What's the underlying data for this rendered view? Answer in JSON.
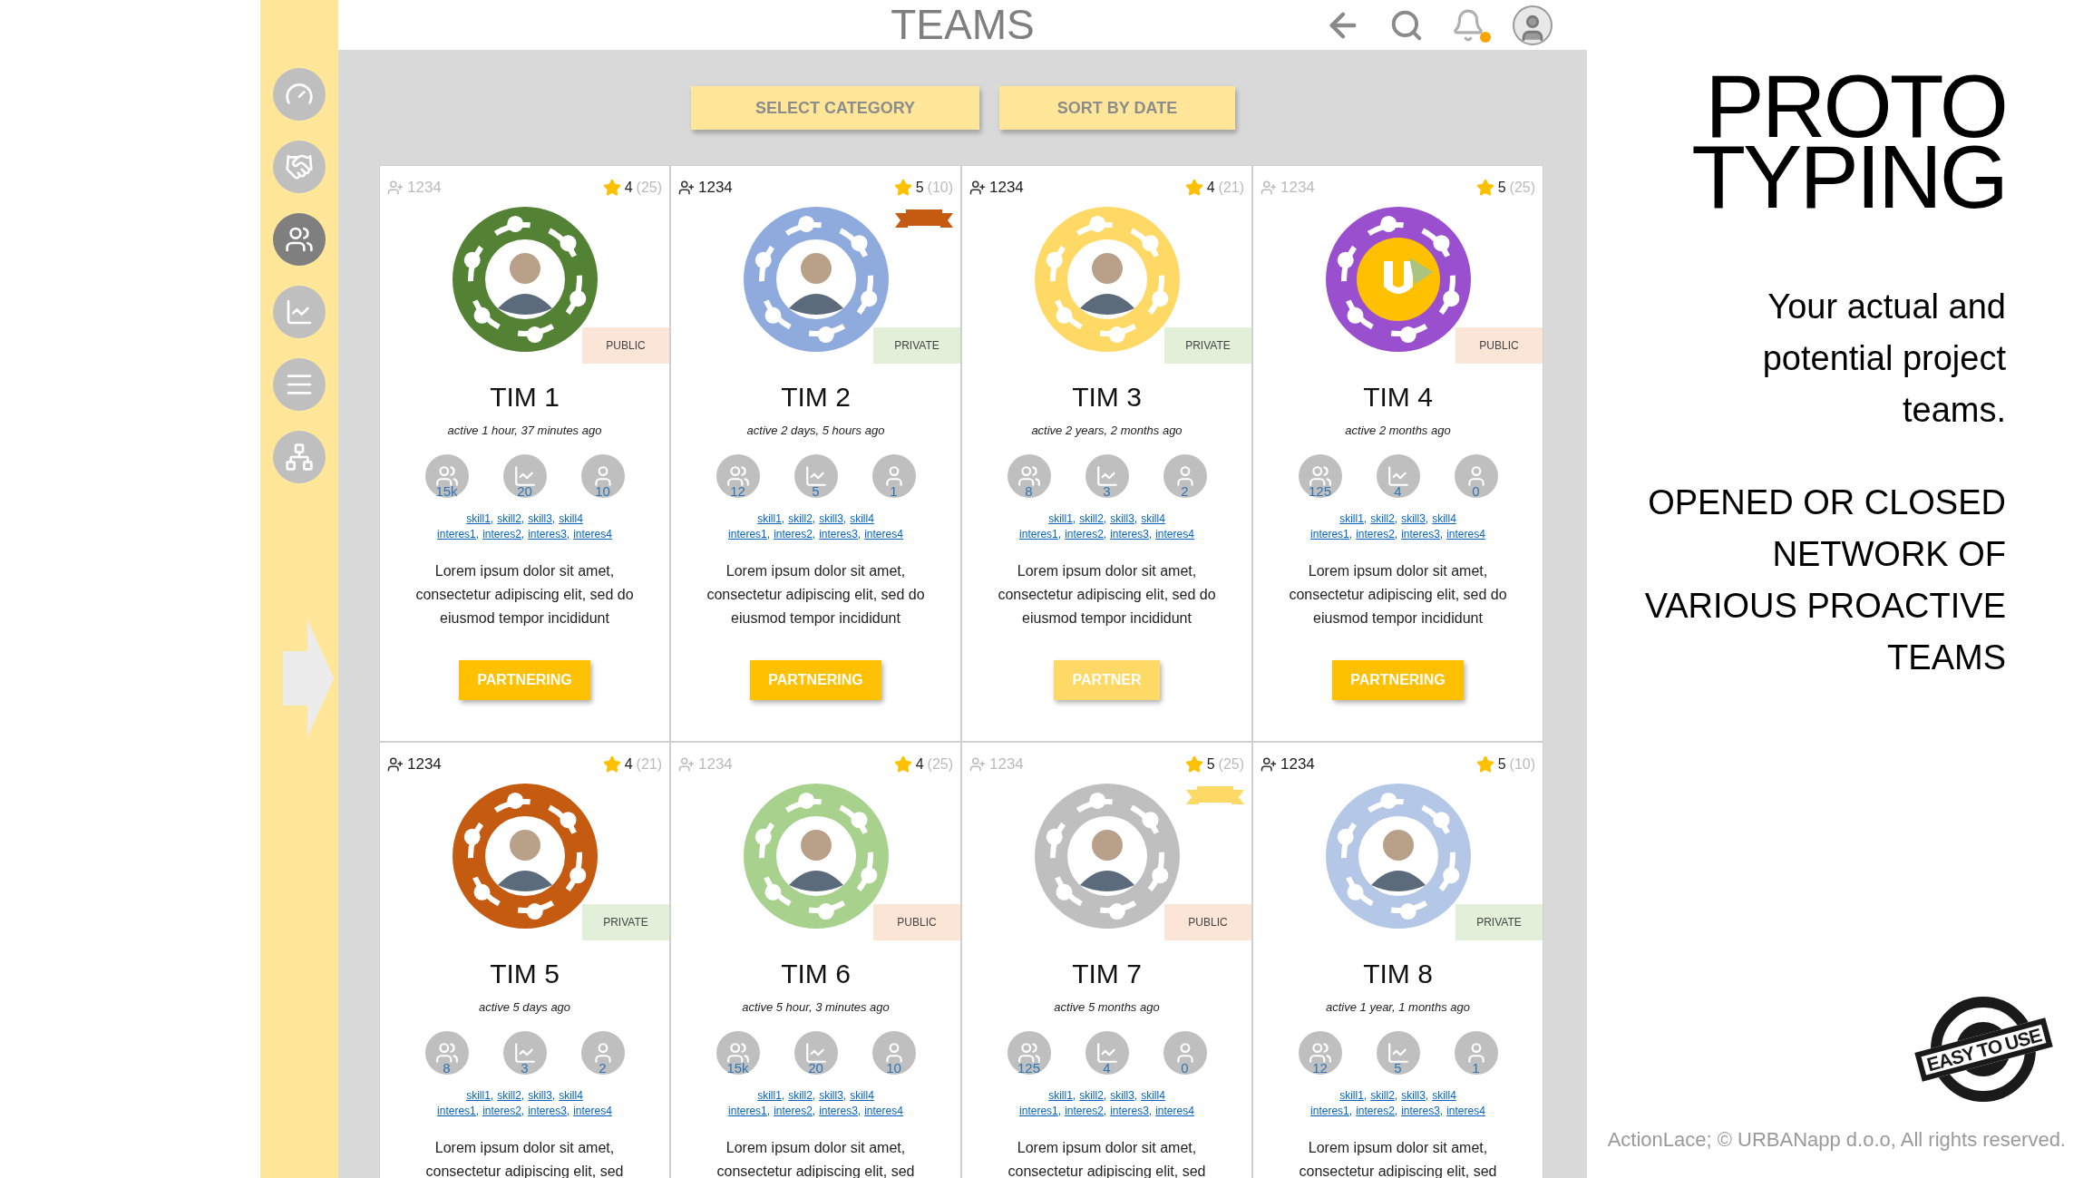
{
  "header": {
    "title": "TEAMS"
  },
  "sidebar": {
    "items": [
      {
        "kind": "gauge",
        "selected": false
      },
      {
        "kind": "handshake",
        "selected": false
      },
      {
        "kind": "teams",
        "selected": true
      },
      {
        "kind": "chart",
        "selected": false
      },
      {
        "kind": "list",
        "selected": false
      },
      {
        "kind": "network",
        "selected": false
      }
    ]
  },
  "filters": [
    "SELECT CATEGORY",
    "SORT BY DATE"
  ],
  "cards": [
    {
      "members": "1234",
      "members_highlighted": false,
      "rating": "4",
      "reviews": "(25)",
      "color": "#548235",
      "avatar": {
        "kind": "photo"
      },
      "visibility": {
        "label": "PUBLIC",
        "kind": "public"
      },
      "name": "TIM 1",
      "activity": "active 1 hour, 37 minutes ago",
      "stats": [
        "15k",
        "20",
        "10"
      ],
      "skills": [
        "skill1,",
        "skill2,",
        "skill3,",
        "skill4"
      ],
      "interests": [
        "interes1,",
        "interes2,",
        "interes3,",
        "interes4"
      ],
      "description": "Lorem ipsum dolor sit amet, consectetur adipiscing elit, sed do eiusmod tempor incididunt",
      "action": {
        "label": "PARTNERING",
        "disabled": false
      }
    },
    {
      "members": "1234",
      "members_highlighted": true,
      "rating": "5",
      "reviews": "(10)",
      "ribbon": {
        "color": "#c55a11"
      },
      "color": "#8faadc",
      "avatar": {
        "kind": "photo"
      },
      "visibility": {
        "label": "PRIVATE",
        "kind": "private"
      },
      "name": "TIM 2",
      "activity": "active 2 days, 5 hours ago",
      "stats": [
        "12",
        "5",
        "1"
      ],
      "skills": [
        "skill1,",
        "skill2,",
        "skill3,",
        "skill4"
      ],
      "interests": [
        "interes1,",
        "interes2,",
        "interes3,",
        "interes4"
      ],
      "description": "Lorem ipsum dolor sit amet, consectetur adipiscing elit, sed do eiusmod tempor incididunt",
      "action": {
        "label": "PARTNERING",
        "disabled": false
      }
    },
    {
      "members": "1234",
      "members_highlighted": true,
      "rating": "4",
      "reviews": "(21)",
      "color": "#ffd966",
      "avatar": {
        "kind": "photo"
      },
      "visibility": {
        "label": "PRIVATE",
        "kind": "private"
      },
      "name": "TIM 3",
      "activity": "active 2 years, 2 months ago",
      "stats": [
        "8",
        "3",
        "2"
      ],
      "skills": [
        "skill1,",
        "skill2,",
        "skill3,",
        "skill4"
      ],
      "interests": [
        "interes1,",
        "interes2,",
        "interes3,",
        "interes4"
      ],
      "description": "Lorem ipsum dolor sit amet, consectetur adipiscing elit, sed do eiusmod tempor incididunt",
      "action": {
        "label": "PARTNER",
        "disabled": true
      }
    },
    {
      "members": "1234",
      "members_highlighted": false,
      "rating": "5",
      "reviews": "(25)",
      "color": "#9a4fcf",
      "avatar": {
        "kind": "logo"
      },
      "visibility": {
        "label": "PUBLIC",
        "kind": "public"
      },
      "name": "TIM 4",
      "activity": "active 2 months ago",
      "stats": [
        "125",
        "4",
        "0"
      ],
      "skills": [
        "skill1,",
        "skill2,",
        "skill3,",
        "skill4"
      ],
      "interests": [
        "interes1,",
        "interes2,",
        "interes3,",
        "interes4"
      ],
      "description": "Lorem ipsum dolor sit amet, consectetur adipiscing elit, sed do eiusmod tempor incididunt",
      "action": {
        "label": "PARTNERING",
        "disabled": false
      }
    },
    {
      "members": "1234",
      "members_highlighted": true,
      "rating": "4",
      "reviews": "(21)",
      "color": "#c55a11",
      "avatar": {
        "kind": "photo"
      },
      "visibility": {
        "label": "PRIVATE",
        "kind": "private"
      },
      "name": "TIM 5",
      "activity": "active 5 days ago",
      "stats": [
        "8",
        "3",
        "2"
      ],
      "skills": [
        "skill1,",
        "skill2,",
        "skill3,",
        "skill4"
      ],
      "interests": [
        "interes1,",
        "interes2,",
        "interes3,",
        "interes4"
      ],
      "description": "Lorem ipsum dolor sit amet, consectetur adipiscing elit, sed"
    },
    {
      "members": "1234",
      "members_highlighted": false,
      "rating": "4",
      "reviews": "(25)",
      "color": "#a9d18e",
      "avatar": {
        "kind": "photo"
      },
      "visibility": {
        "label": "PUBLIC",
        "kind": "public"
      },
      "name": "TIM 6",
      "activity": "active 5 hour, 3 minutes ago",
      "stats": [
        "15k",
        "20",
        "10"
      ],
      "skills": [
        "skill1,",
        "skill2,",
        "skill3,",
        "skill4"
      ],
      "interests": [
        "interes1,",
        "interes2,",
        "interes3,",
        "interes4"
      ],
      "description": "Lorem ipsum dolor sit amet, consectetur adipiscing elit, sed"
    },
    {
      "members": "1234",
      "members_highlighted": false,
      "rating": "5",
      "reviews": "(25)",
      "ribbon": {
        "color": "#ffd966"
      },
      "color": "#bfbfbf",
      "avatar": {
        "kind": "photo"
      },
      "visibility": {
        "label": "PUBLIC",
        "kind": "public"
      },
      "name": "TIM 7",
      "activity": "active 5 months ago",
      "stats": [
        "125",
        "4",
        "0"
      ],
      "skills": [
        "skill1,",
        "skill2,",
        "skill3,",
        "skill4"
      ],
      "interests": [
        "interes1,",
        "interes2,",
        "interes3,",
        "interes4"
      ],
      "description": "Lorem ipsum dolor sit amet, consectetur adipiscing elit, sed"
    },
    {
      "members": "1234",
      "members_highlighted": true,
      "rating": "5",
      "reviews": "(10)",
      "color": "#b4c7e7",
      "avatar": {
        "kind": "photo"
      },
      "visibility": {
        "label": "PRIVATE",
        "kind": "private"
      },
      "name": "TIM 8",
      "activity": "active 1 year, 1 months ago",
      "stats": [
        "12",
        "5",
        "1"
      ],
      "skills": [
        "skill1,",
        "skill2,",
        "skill3,",
        "skill4"
      ],
      "interests": [
        "interes1,",
        "interes2,",
        "interes3,",
        "interes4"
      ],
      "description": "Lorem ipsum dolor sit amet, consectetur adipiscing elit, sed"
    }
  ],
  "slide": {
    "title_lines": [
      "PROTO",
      "TYPING"
    ],
    "subtitle_lines": [
      "Your actual and",
      "potential project",
      "teams."
    ],
    "tagline_lines": [
      "OPENED OR CLOSED",
      "NETWORK OF",
      "VARIOUS PROACTIVE",
      "TEAMS"
    ],
    "stamp": "EASY TO USE",
    "footer": "ActionLace; © URBANapp d.o.o, All rights reserved."
  }
}
